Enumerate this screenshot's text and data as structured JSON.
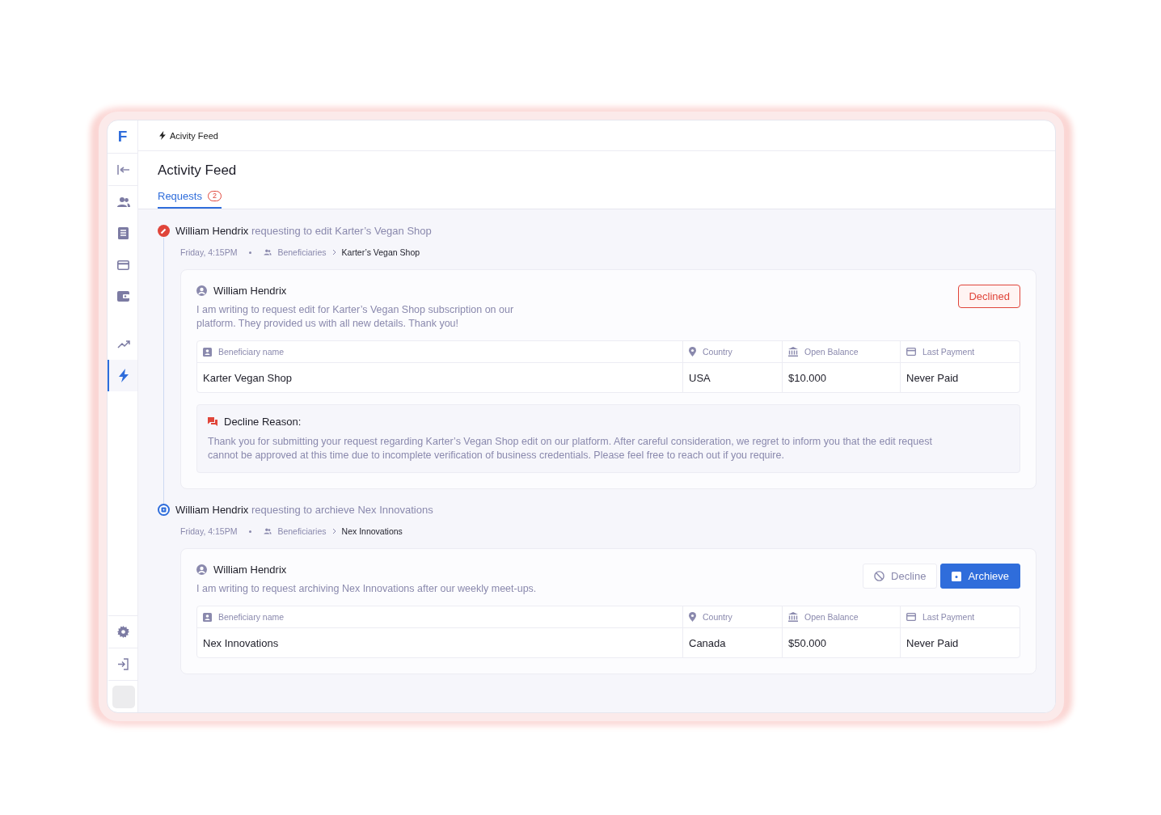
{
  "sidebar": {
    "logo": "F",
    "items": [
      {
        "kind": "collapse",
        "selected": false
      },
      {
        "kind": "users",
        "selected": false
      },
      {
        "kind": "list",
        "selected": false
      },
      {
        "kind": "card",
        "selected": false
      },
      {
        "kind": "wallet",
        "selected": false
      },
      {
        "kind": "chart",
        "selected": false
      },
      {
        "kind": "bolt",
        "selected": true
      }
    ],
    "bottom": [
      {
        "kind": "settings"
      },
      {
        "kind": "logout"
      }
    ]
  },
  "breadcrumb": "Acivity Feed",
  "title": "Activity Feed",
  "tabs": [
    {
      "label": "Requests",
      "count": "2",
      "selected": true
    }
  ],
  "requests": [
    {
      "kind": "edit",
      "name": "William Hendrix",
      "action": "requesting to edit Karter’s Vegan Shop",
      "time": "Friday, 4:15PM",
      "section": "Beneficiaries",
      "item": "Karter’s Vegan Shop",
      "author": "William Hendrix",
      "message": "I am writing to request edit for Karter’s Vegan Shop subscription on our platform. They provided us with all new details. Thank you!",
      "status": "Declined",
      "columns": [
        "Beneficiary name",
        "Country",
        "Open Balance",
        "Last Payment"
      ],
      "row": [
        "Karter Vegan Shop",
        "USA",
        "$10.000",
        "Never Paid"
      ],
      "reason": {
        "title": "Decline Reason:",
        "text": "Thank you for submitting your request regarding Karter’s Vegan Shop edit on our platform. After careful consideration, we regret to inform you that the edit request cannot be approved at this time due to incomplete verification of business credentials. Please feel free to reach out if you require."
      }
    },
    {
      "kind": "archive",
      "name": "William Hendrix",
      "action": "requesting to archieve Nex Innovations",
      "time": "Friday, 4:15PM",
      "section": "Beneficiaries",
      "item": "Nex Innovations",
      "author": "William Hendrix",
      "message": "I am writing to request archiving Nex Innovations after our weekly meet-ups.",
      "buttons": [
        {
          "kind": "secondary",
          "label": "Decline"
        },
        {
          "kind": "primary",
          "label": "Archieve"
        }
      ],
      "columns": [
        "Beneficiary name",
        "Country",
        "Open Balance",
        "Last Payment"
      ],
      "row": [
        "Nex Innovations",
        "Canada",
        "$50.000",
        "Never Paid"
      ]
    }
  ]
}
